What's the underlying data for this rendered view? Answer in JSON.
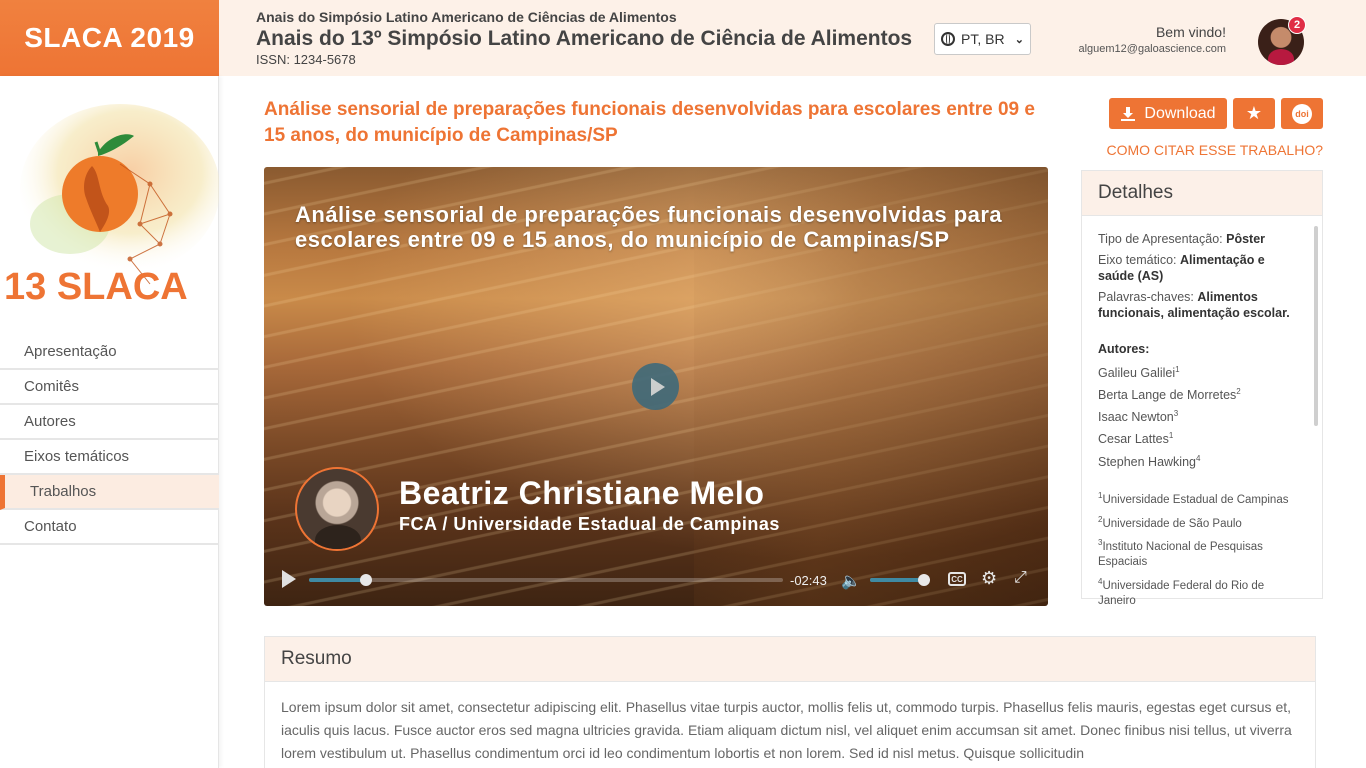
{
  "header": {
    "brand": "SLACA 2019",
    "subtitle": "Anais do Simpósio Latino Americano de Ciências de Alimentos",
    "title": "Anais do 13º Simpósio Latino Americano de Ciência de Alimentos",
    "issn": "ISSN: 1234-5678",
    "language": "PT, BR",
    "welcome": "Bem vindo!",
    "email": "alguem12@galoascience.com",
    "notifications": "2"
  },
  "logo": {
    "text": "13 SLACA"
  },
  "nav": {
    "items": [
      {
        "label": "Apresentação"
      },
      {
        "label": "Comitês"
      },
      {
        "label": "Autores"
      },
      {
        "label": "Eixos temáticos"
      },
      {
        "label": "Trabalhos"
      },
      {
        "label": "Contato"
      }
    ],
    "active_index": 4
  },
  "paper": {
    "title": "Análise sensorial de preparações funcionais desenvolvidas para escolares entre 09 e 15 anos, do município de Campinas/SP"
  },
  "actions": {
    "download": "Download",
    "doi": "doi",
    "cite": "COMO CITAR ESSE TRABALHO?"
  },
  "video": {
    "title": "Análise sensorial de preparações funcionais desenvolvidas para escolares entre 09 e 15 anos, do município de Campinas/SP",
    "presenter_name": "Beatriz Christiane Melo",
    "presenter_institution": "FCA / Universidade Estadual de Campinas",
    "time_remaining": "-02:43",
    "progress": 0.12,
    "volume": 0.9,
    "cc": "CC"
  },
  "details": {
    "heading": "Detalhes",
    "type_label": "Tipo de Apresentação:",
    "type_value": "Pôster",
    "axis_label": "Eixo temático:",
    "axis_value": "Alimentação e saúde (AS)",
    "keywords_label": "Palavras-chaves:",
    "keywords_value": "Alimentos funcionais, alimentação escolar.",
    "authors_label": "Autores:",
    "authors": [
      {
        "name": "Galileu Galilei",
        "sup": "1"
      },
      {
        "name": "Berta Lange de Morretes",
        "sup": "2"
      },
      {
        "name": "Isaac Newton",
        "sup": "3"
      },
      {
        "name": "Cesar Lattes",
        "sup": "1"
      },
      {
        "name": "Stephen Hawking",
        "sup": "4"
      }
    ],
    "affiliations": [
      {
        "sup": "1",
        "name": "Universidade Estadual de Campinas"
      },
      {
        "sup": "2",
        "name": "Universidade de São Paulo"
      },
      {
        "sup": "3",
        "name": "Instituto Nacional de Pesquisas Espaciais"
      },
      {
        "sup": "4",
        "name": "Universidade Federal do Rio de Janeiro"
      }
    ]
  },
  "resumo": {
    "heading": "Resumo",
    "text": "Lorem ipsum dolor sit amet, consectetur adipiscing elit. Phasellus vitae turpis auctor, mollis felis ut, commodo turpis. Phasellus felis mauris, egestas eget cursus et, iaculis quis lacus. Fusce auctor eros sed magna ultricies gravida. Etiam aliquam dictum nisl, vel aliquet enim accumsan sit amet. Donec finibus nisi tellus, ut viverra lorem vestibulum ut. Phasellus condimentum orci id leo condimentum lobortis et non lorem. Sed id nisl metus. Quisque sollicitudin"
  },
  "colors": {
    "accent": "#ee7434",
    "header_bg": "#fdf1e8",
    "panel_head": "#fcf0e8"
  }
}
